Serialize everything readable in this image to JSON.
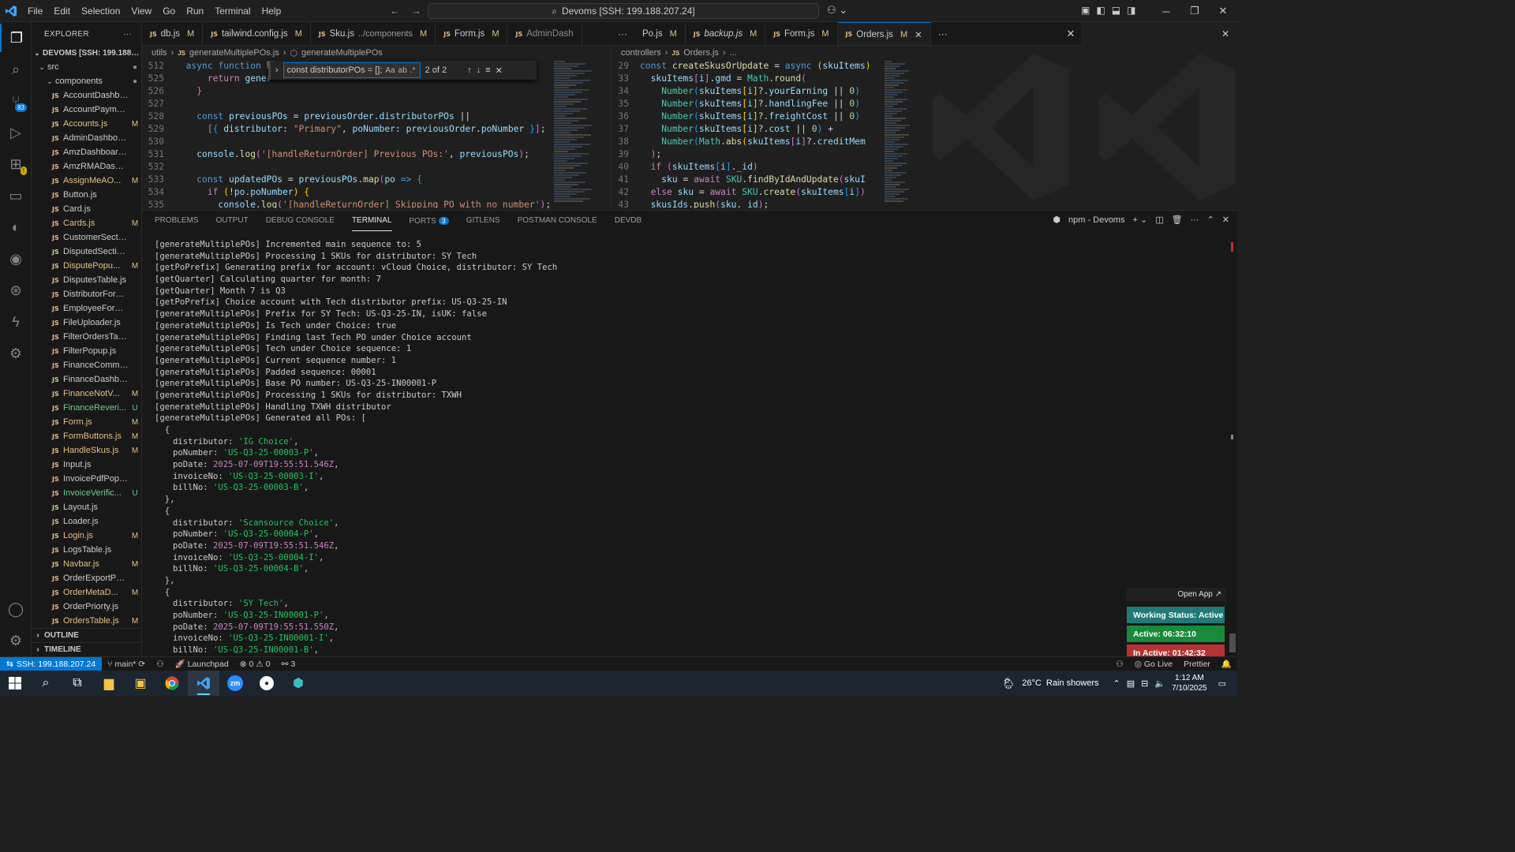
{
  "titlebar": {
    "menu": [
      "File",
      "Edit",
      "Selection",
      "View",
      "Go",
      "Run",
      "Terminal",
      "Help"
    ],
    "search_text": "Devoms [SSH: 199.188.207.24]"
  },
  "sidebar": {
    "title": "EXPLORER",
    "root": "DEVOMS [SSH: 199.188.20...",
    "src": "src",
    "components": "components",
    "files": [
      {
        "name": "AccountDashboar...",
        "status": "",
        "cls": ""
      },
      {
        "name": "AccountPaymentP...",
        "status": "",
        "cls": ""
      },
      {
        "name": "Accounts.js",
        "status": "M",
        "cls": "mod"
      },
      {
        "name": "AdminDashboard.js",
        "status": "",
        "cls": ""
      },
      {
        "name": "AmzDashboard.js",
        "status": "",
        "cls": ""
      },
      {
        "name": "AmzRMADashboar...",
        "status": "",
        "cls": ""
      },
      {
        "name": "AssignMeAO...",
        "status": "M",
        "cls": "mod"
      },
      {
        "name": "Button.js",
        "status": "",
        "cls": ""
      },
      {
        "name": "Card.js",
        "status": "",
        "cls": ""
      },
      {
        "name": "Cards.js",
        "status": "M",
        "cls": "mod"
      },
      {
        "name": "CustomerSection.js",
        "status": "",
        "cls": ""
      },
      {
        "name": "DisputedSection.js",
        "status": "",
        "cls": ""
      },
      {
        "name": "DisputePopu...",
        "status": "M",
        "cls": "mod"
      },
      {
        "name": "DisputesTable.js",
        "status": "",
        "cls": ""
      },
      {
        "name": "DistributorForm.js",
        "status": "",
        "cls": ""
      },
      {
        "name": "EmployeeForm.js",
        "status": "",
        "cls": ""
      },
      {
        "name": "FileUploader.js",
        "status": "",
        "cls": ""
      },
      {
        "name": "FilterOrdersTable.js",
        "status": "",
        "cls": ""
      },
      {
        "name": "FilterPopup.js",
        "status": "",
        "cls": ""
      },
      {
        "name": "FinanceComments.js",
        "status": "",
        "cls": ""
      },
      {
        "name": "FinanceDashboard.js",
        "status": "",
        "cls": ""
      },
      {
        "name": "FinanceNotV...",
        "status": "M",
        "cls": "mod"
      },
      {
        "name": "FinanceReveri...",
        "status": "U",
        "cls": "untr"
      },
      {
        "name": "Form.js",
        "status": "M",
        "cls": "mod"
      },
      {
        "name": "FormButtons.js",
        "status": "M",
        "cls": "mod"
      },
      {
        "name": "HandleSkus.js",
        "status": "M",
        "cls": "mod"
      },
      {
        "name": "Input.js",
        "status": "",
        "cls": ""
      },
      {
        "name": "InvoicePdfPopup.js",
        "status": "",
        "cls": ""
      },
      {
        "name": "InvoiceVerific...",
        "status": "U",
        "cls": "untr"
      },
      {
        "name": "Layout.js",
        "status": "",
        "cls": ""
      },
      {
        "name": "Loader.js",
        "status": "",
        "cls": ""
      },
      {
        "name": "Login.js",
        "status": "M",
        "cls": "mod"
      },
      {
        "name": "LogsTable.js",
        "status": "",
        "cls": ""
      },
      {
        "name": "Navbar.js",
        "status": "M",
        "cls": "mod"
      },
      {
        "name": "OrderExportPopup.js",
        "status": "",
        "cls": ""
      },
      {
        "name": "OrderMetaD...",
        "status": "M",
        "cls": "mod"
      },
      {
        "name": "OrderPriorty.js",
        "status": "",
        "cls": ""
      },
      {
        "name": "OrdersTable.js",
        "status": "M",
        "cls": "mod"
      }
    ],
    "outline": "OUTLINE",
    "timeline": "TIMELINE"
  },
  "tabs": [
    {
      "icon": "JS",
      "name": "db.js",
      "desc": "",
      "status": "M",
      "state": ""
    },
    {
      "icon": "JS",
      "name": "tailwind.config.js",
      "desc": "",
      "status": "M",
      "state": ""
    },
    {
      "icon": "JS",
      "name": "Sku.js",
      "desc": "../components",
      "status": "M",
      "state": ""
    },
    {
      "icon": "JS",
      "name": "Form.js",
      "desc": "",
      "status": "M",
      "state": ""
    },
    {
      "icon": "JS",
      "name": "AdminDash",
      "desc": "",
      "status": "",
      "state": "dim"
    }
  ],
  "tabs_right": [
    {
      "icon": "",
      "name": "Po.js",
      "desc": "",
      "status": "M",
      "state": ""
    },
    {
      "icon": "JS",
      "name": "backup.js",
      "desc": "",
      "status": "M",
      "state": "italic"
    },
    {
      "icon": "JS",
      "name": "Form.js",
      "desc": "",
      "status": "M",
      "state": ""
    },
    {
      "icon": "JS",
      "name": "Orders.js",
      "desc": "",
      "status": "M",
      "state": "active"
    }
  ],
  "left_editor": {
    "crumbs": [
      "utils",
      "generateMultiplePOs.js",
      "generateMultiplePOs"
    ],
    "find": {
      "query": "const distributorPOs = [];",
      "count": "2 of 2"
    }
  },
  "right_editor": {
    "crumbs": [
      "controllers",
      "Orders.js",
      "..."
    ]
  },
  "panel": {
    "tabs": [
      "PROBLEMS",
      "OUTPUT",
      "DEBUG CONSOLE",
      "TERMINAL",
      "PORTS",
      "GITLENS",
      "POSTMAN CONSOLE",
      "DEVDB"
    ],
    "ports_count": "3",
    "terminal_name": "npm - Devoms",
    "log_lines": [
      "[generateMultiplePOs] Incremented main sequence to: 5",
      "[generateMultiplePOs] Processing 1 SKUs for distributor: SY Tech",
      "[getPoPrefix] Generating prefix for account: vCloud Choice, distributor: SY Tech",
      "[getQuarter] Calculating quarter for month: 7",
      "[getQuarter] Month 7 is Q3",
      "[getPoPrefix] Choice account with Tech distributor prefix: US-Q3-25-IN",
      "[generateMultiplePOs] Prefix for SY Tech: US-Q3-25-IN, isUK: false",
      "[generateMultiplePOs] Is Tech under Choice: true",
      "[generateMultiplePOs] Finding last Tech PO under Choice account",
      "[generateMultiplePOs] Tech under Choice sequence: 1",
      "[generateMultiplePOs] Current sequence number: 1",
      "[generateMultiplePOs] Padded sequence: 00001",
      "[generateMultiplePOs] Base PO number: US-Q3-25-IN00001-P",
      "[generateMultiplePOs] Processing 1 SKUs for distributor: TXWH",
      "[generateMultiplePOs] Handling TXWH distributor",
      "[generateMultiplePOs] Generated all POs: ["
    ],
    "pos": [
      {
        "distributor": "'IG Choice'",
        "poNumber": "'US-Q3-25-00003-P'",
        "poDate": "2025-07-09T19:55:51.546Z",
        "invoiceNo": "'US-Q3-25-00003-I'",
        "billNo": "'US-Q3-25-00003-B'"
      },
      {
        "distributor": "'Scansource Choice'",
        "poNumber": "'US-Q3-25-00004-P'",
        "poDate": "2025-07-09T19:55:51.546Z",
        "invoiceNo": "'US-Q3-25-00004-I'",
        "billNo": "'US-Q3-25-00004-B'"
      },
      {
        "distributor": "'SY Tech'",
        "poNumber": "'US-Q3-25-IN00001-P'",
        "poDate": "2025-07-09T19:55:51.550Z",
        "invoiceNo": "'US-Q3-25-IN00001-I'",
        "billNo": "'US-Q3-25-IN00001-B'"
      }
    ],
    "keys": {
      "distributor": "distributor:",
      "poNumber": "poNumber:",
      "poDate": "poDate:",
      "invoiceNo": "invoiceNo:",
      "billNo": "billNo:"
    }
  },
  "work_status": {
    "open_app": "Open App ↗",
    "status": "Working Status: Active",
    "active": "Active: 06:32:10",
    "inactive": "In Active: 01:42:32",
    "colors": {
      "status": "#1f7a78",
      "active": "#1a8a3a",
      "inactive": "#b83232"
    }
  },
  "statusbar": {
    "remote": "SSH: 199.188.207.24",
    "branch": "main*",
    "launchpad": "Launchpad",
    "errors": "0",
    "warnings": "0",
    "ports": "3",
    "golive": "Go Live",
    "prettier": "Prettier"
  },
  "taskbar": {
    "weather": "26°C  Rain showers",
    "time": "1:12 AM",
    "date": "7/10/2025"
  }
}
